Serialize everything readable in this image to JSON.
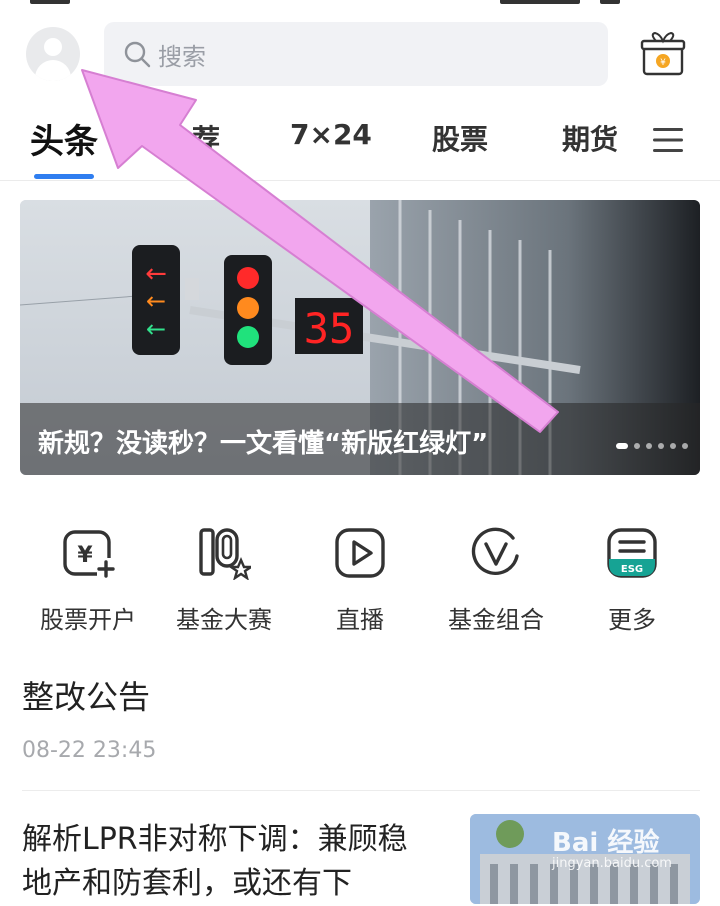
{
  "header": {
    "search_placeholder": "搜索"
  },
  "tabs": [
    {
      "label": "头条",
      "active": true
    },
    {
      "label": "荐",
      "active": false
    },
    {
      "label": "7×24",
      "active": false
    },
    {
      "label": "股票",
      "active": false
    },
    {
      "label": "期货",
      "active": false
    }
  ],
  "banner": {
    "caption": "新规？没读秒？一文看懂“新版红绿灯”",
    "countdown_display": "35",
    "slide_count": 6,
    "active_slide": 1
  },
  "shortcuts": [
    {
      "label": "股票开户",
      "icon": "yuan-card-icon"
    },
    {
      "label": "基金大赛",
      "icon": "fund-contest-icon"
    },
    {
      "label": "直播",
      "icon": "play-icon"
    },
    {
      "label": "基金组合",
      "icon": "v-circle-icon"
    },
    {
      "label": "更多",
      "icon": "esg-more-icon",
      "badge": "ESG"
    }
  ],
  "notice": {
    "title": "整改公告",
    "time": "08-22 23:45"
  },
  "article": {
    "title": "解析LPR非对称下调：兼顾稳地产和防套利，或还有下"
  },
  "watermark": {
    "brand": "Bai 经验",
    "url": "jingyan.baidu.com"
  },
  "colors": {
    "accent": "#2f7ef0",
    "annotation_arrow": "#f2a6ee",
    "esg_green": "#16a394"
  }
}
